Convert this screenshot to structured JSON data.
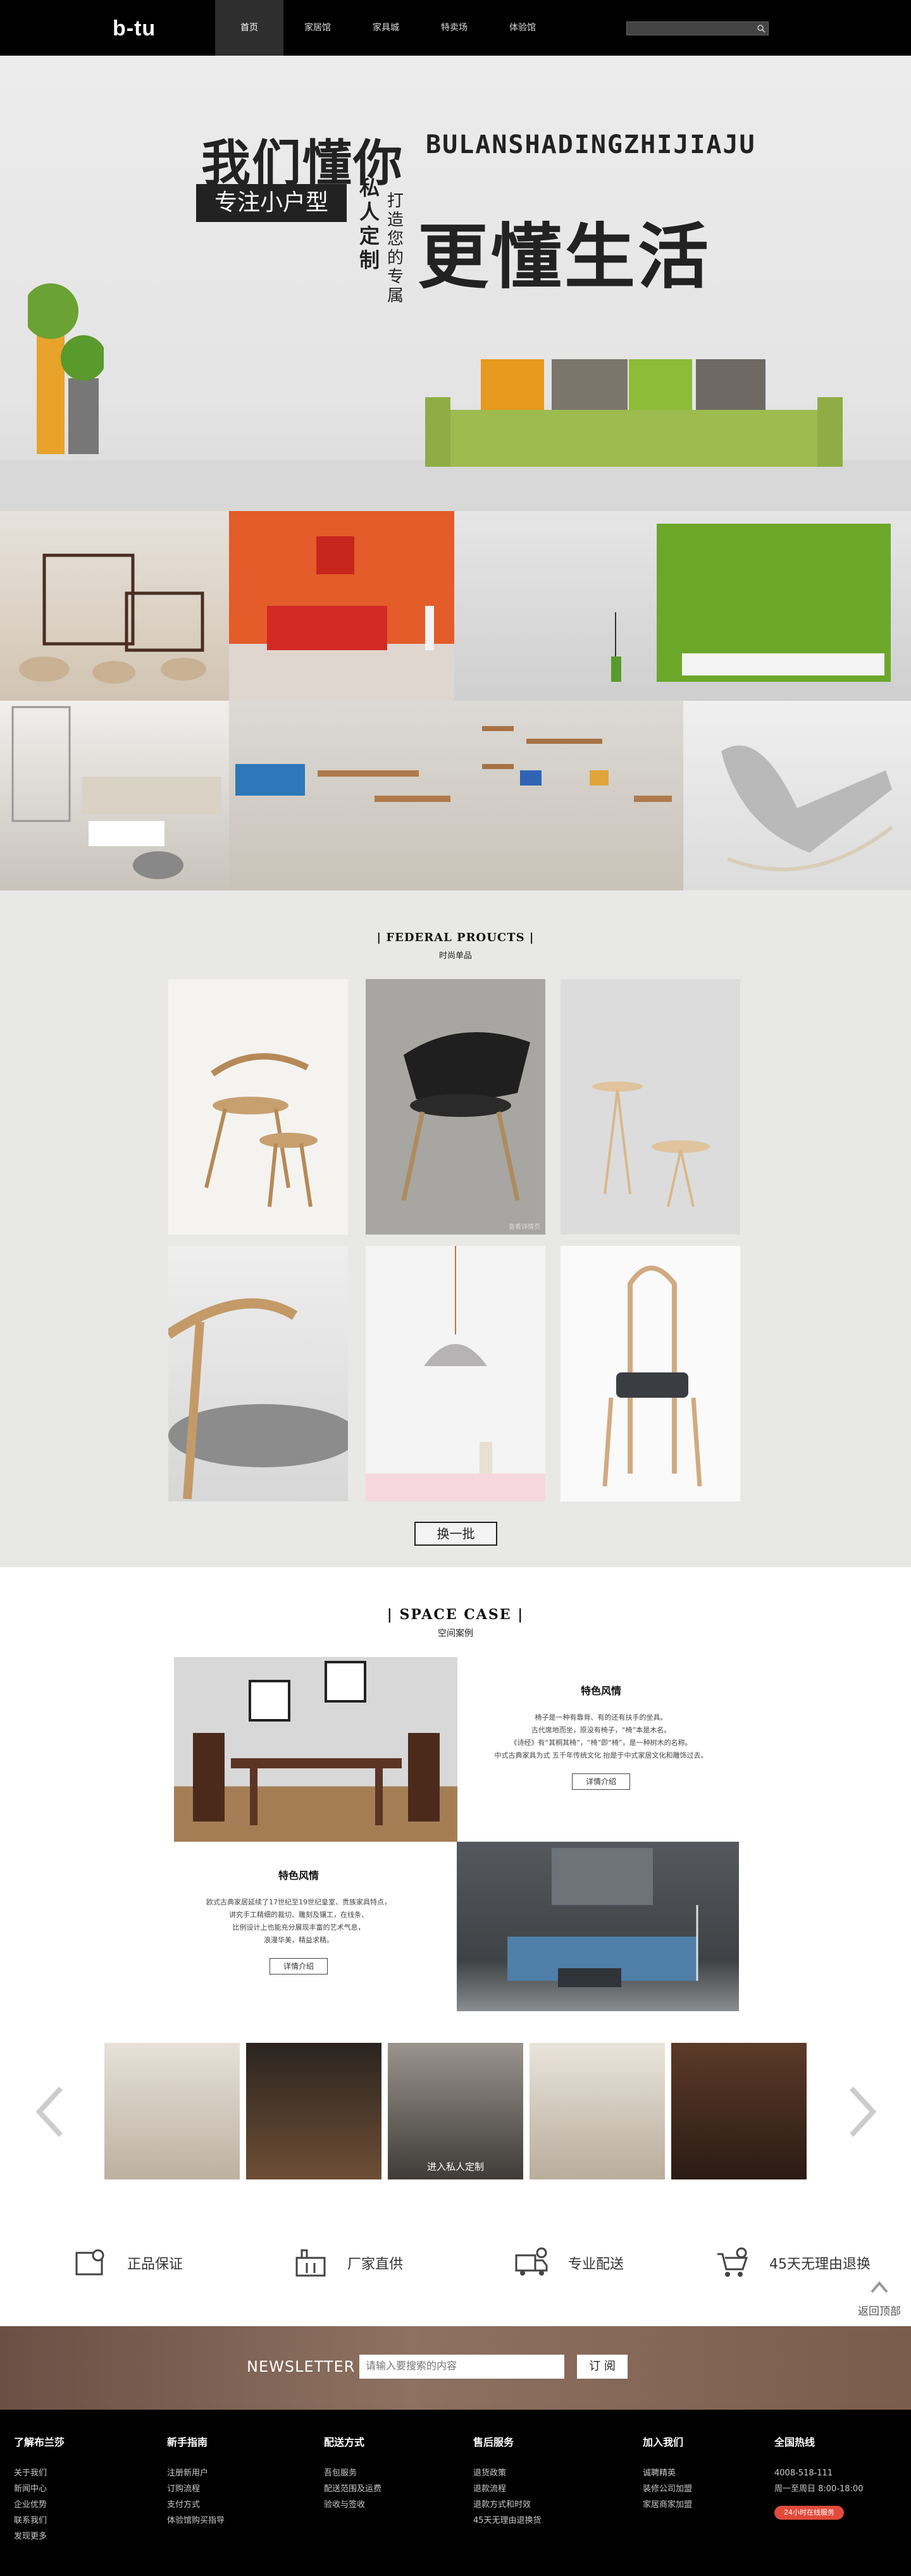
{
  "brand": {
    "logo": "b-tu"
  },
  "nav": {
    "items": [
      "首页",
      "家居馆",
      "家具城",
      "特卖场",
      "体验馆"
    ],
    "active": 0
  },
  "search": {
    "placeholder": ""
  },
  "hero": {
    "title1": "我们懂你",
    "tag": "专注小户型",
    "vertical1": "私人定制",
    "vertical2": "打造您的专属",
    "latin": "BULANSHADINGZHIJIAJU",
    "title2": "更懂生活",
    "slide_count": 3,
    "active_slide": 0
  },
  "products": {
    "title": "| FEDERAL  PROUCTS |",
    "subtitle": "时尚单品",
    "card_caption": "查看详情页",
    "swap_button": "换一批"
  },
  "space": {
    "title": "| SPACE  CASE |",
    "subtitle": "空间案例",
    "case1": {
      "title": "特色风情",
      "desc": [
        "椅子是一种有靠背、有的还有扶手的坐具。",
        "古代席地而坐，原没有椅子，“椅”本是木名。",
        "《诗经》有“其桐其椅”，“椅”即“椅”，是一种树木的名称。",
        "中式古典家具为式 五千年传统文化 抬是于中式家居文化和雕饰过去。"
      ],
      "button": "详情介绍"
    },
    "case2": {
      "title": "特色风情",
      "desc": [
        "欧式古典家居延续了17世纪至19世纪皇室、贵族家具特点，",
        "讲究手工精细的裁切、雕刻及镶工，在线条、",
        "比例设计上也能充分展现丰富的艺术气息，",
        "浪漫华美，精益求精。"
      ],
      "button": "详情介绍"
    },
    "gallery_caption": "进入私人定制"
  },
  "features": [
    {
      "icon": "certificate-icon",
      "label": "正品保证"
    },
    {
      "icon": "factory-icon",
      "label": "厂家直供"
    },
    {
      "icon": "delivery-truck-icon",
      "label": "专业配送"
    },
    {
      "icon": "cart-return-icon",
      "label": "45天无理由退换"
    }
  ],
  "back_to_top": "返回顶部",
  "newsletter": {
    "label": "NEWSLETTER",
    "placeholder": "请输入要搜索的内容",
    "button": "订 阅"
  },
  "footer": {
    "columns": [
      {
        "title": "了解布兰莎",
        "links": [
          "关于我们",
          "新闻中心",
          "企业优势",
          "联系我们",
          "发现更多"
        ]
      },
      {
        "title": "新手指南",
        "links": [
          "注册新用户",
          "订购流程",
          "支付方式",
          "体验馆购买指导"
        ]
      },
      {
        "title": "配送方式",
        "links": [
          "吾包服务",
          "配送范围及运费",
          "验收与签收"
        ]
      },
      {
        "title": "售后服务",
        "links": [
          "退货政策",
          "退款流程",
          "退款方式和时效",
          "45天无理由退换货"
        ]
      },
      {
        "title": "加入我们",
        "links": [
          "诚聘精英",
          "装修公司加盟",
          "家居商家加盟"
        ]
      },
      {
        "title": "全国热线",
        "links": [
          "4008-518-111",
          "周一至周日 8:00-18:00"
        ],
        "badge": "24小时在线服务"
      }
    ]
  },
  "colors": {
    "nav_bg": "#000000",
    "accent_red": "#e24a3b",
    "section_gray": "#e8e9e7",
    "sofa_green": "#9dbb4e"
  }
}
